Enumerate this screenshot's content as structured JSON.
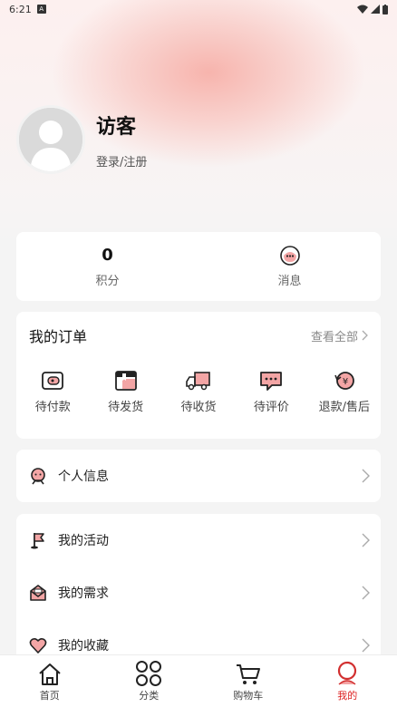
{
  "status_bar": {
    "time": "6:21"
  },
  "profile": {
    "name": "访客",
    "login_label": "登录/注册"
  },
  "stats": [
    {
      "value": "0",
      "label": "积分"
    },
    {
      "value": "",
      "label": "消息"
    }
  ],
  "orders": {
    "title": "我的订单",
    "view_all": "查看全部",
    "items": [
      {
        "label": "待付款",
        "icon": "wallet-icon"
      },
      {
        "label": "待发货",
        "icon": "package-icon"
      },
      {
        "label": "待收货",
        "icon": "truck-icon"
      },
      {
        "label": "待评价",
        "icon": "chat-icon"
      },
      {
        "label": "退款/售后",
        "icon": "refund-icon"
      }
    ]
  },
  "menu": {
    "personal_info": "个人信息",
    "group": [
      {
        "label": "我的活动",
        "icon": "flag-icon"
      },
      {
        "label": "我的需求",
        "icon": "inbox-icon"
      },
      {
        "label": "我的收藏",
        "icon": "heart-icon"
      }
    ]
  },
  "tabs": [
    {
      "label": "首页",
      "icon": "home-icon"
    },
    {
      "label": "分类",
      "icon": "category-icon"
    },
    {
      "label": "购物车",
      "icon": "cart-icon"
    },
    {
      "label": "我的",
      "icon": "profile-icon"
    }
  ],
  "colors": {
    "accent": "#d22f2f",
    "pink": "#f3a5a5"
  }
}
